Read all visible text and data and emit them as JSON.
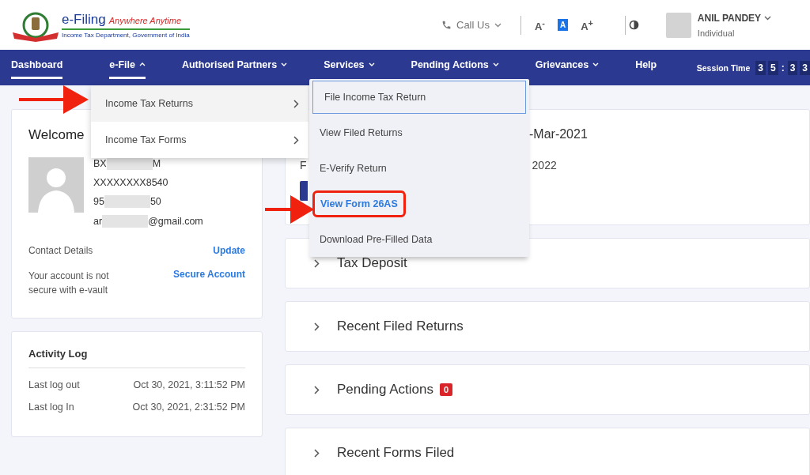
{
  "header": {
    "logo": {
      "title": "e-Filing",
      "tagline": "Anywhere Anytime",
      "subtitle": "Income Tax Department, Government of India"
    },
    "call_us": "Call Us",
    "font_sizes": [
      {
        "label": "A$^{-}$",
        "selected": false
      },
      {
        "label": "A",
        "selected": true
      },
      {
        "label": "A$^{+}$",
        "selected": false
      }
    ],
    "user": {
      "name": "ANIL PANDEY",
      "role": "Individual"
    }
  },
  "nav": {
    "items": [
      {
        "label": "Dashboard",
        "kind": "link",
        "selected": true
      },
      {
        "label": "e-File",
        "kind": "menu",
        "selected": true,
        "expanded": true
      },
      {
        "label": "Authorised Partners",
        "kind": "menu",
        "selected": false,
        "expanded": false
      },
      {
        "label": "Services",
        "kind": "menu",
        "selected": false,
        "expanded": false
      },
      {
        "label": "Pending Actions",
        "kind": "menu",
        "selected": false,
        "expanded": false
      },
      {
        "label": "Grievances",
        "kind": "menu",
        "selected": false,
        "expanded": false
      },
      {
        "label": "Help",
        "kind": "link",
        "selected": false
      }
    ],
    "session": {
      "label": "Session Time",
      "digits": [
        "3",
        "5",
        ":",
        "3",
        "3"
      ]
    }
  },
  "efile_menu": {
    "items": [
      {
        "label": "Income Tax Returns",
        "selected": true
      },
      {
        "label": "Income Tax Forms",
        "selected": false
      }
    ]
  },
  "services_menu": {
    "items": [
      {
        "label": "File Income Tax Return",
        "selected": true,
        "highlighted": false
      },
      {
        "label": "View Filed Returns",
        "selected": false,
        "highlighted": false
      },
      {
        "label": "E-Verify Return",
        "selected": false,
        "highlighted": false
      },
      {
        "label": "View Form 26AS",
        "selected": false,
        "highlighted": true
      },
      {
        "label": "Download Pre-Filled Data",
        "selected": false,
        "highlighted": false
      }
    ]
  },
  "welcome": {
    "title": "Welcome",
    "details": [
      [
        {
          "kind": "text",
          "text": "BX"
        },
        {
          "kind": "redacted"
        },
        {
          "kind": "text",
          "text": "M"
        }
      ],
      [
        {
          "kind": "text",
          "text": "XXXXXXXX8540"
        }
      ],
      [
        {
          "kind": "text",
          "text": "95"
        },
        {
          "kind": "redacted"
        },
        {
          "kind": "text",
          "text": "50"
        }
      ],
      [
        {
          "kind": "text",
          "text": "ar"
        },
        {
          "kind": "redacted"
        },
        {
          "kind": "text",
          "text": "@gmail.com"
        }
      ]
    ],
    "contact": {
      "label": "Contact Details",
      "action": "Update"
    },
    "security": {
      "label": "Your account is not secure with e-vault",
      "action": "Secure Account"
    }
  },
  "activity": {
    "title": "Activity Log",
    "rows": [
      {
        "label": "Last log out",
        "value": "Oct 30, 2021, 3:11:52 PM"
      },
      {
        "label": "Last log In",
        "value": "Oct 30, 2021, 2:31:52 PM"
      }
    ]
  },
  "summary": {
    "title_fragment": "-Mar-2021",
    "text_fragment": "F",
    "date_fragment": "2022"
  },
  "sections": [
    {
      "title": "Tax Deposit"
    },
    {
      "title": "Recent Filed Returns"
    },
    {
      "title": "Pending Actions",
      "badge": "0"
    },
    {
      "title": "Recent Forms Filed"
    }
  ]
}
